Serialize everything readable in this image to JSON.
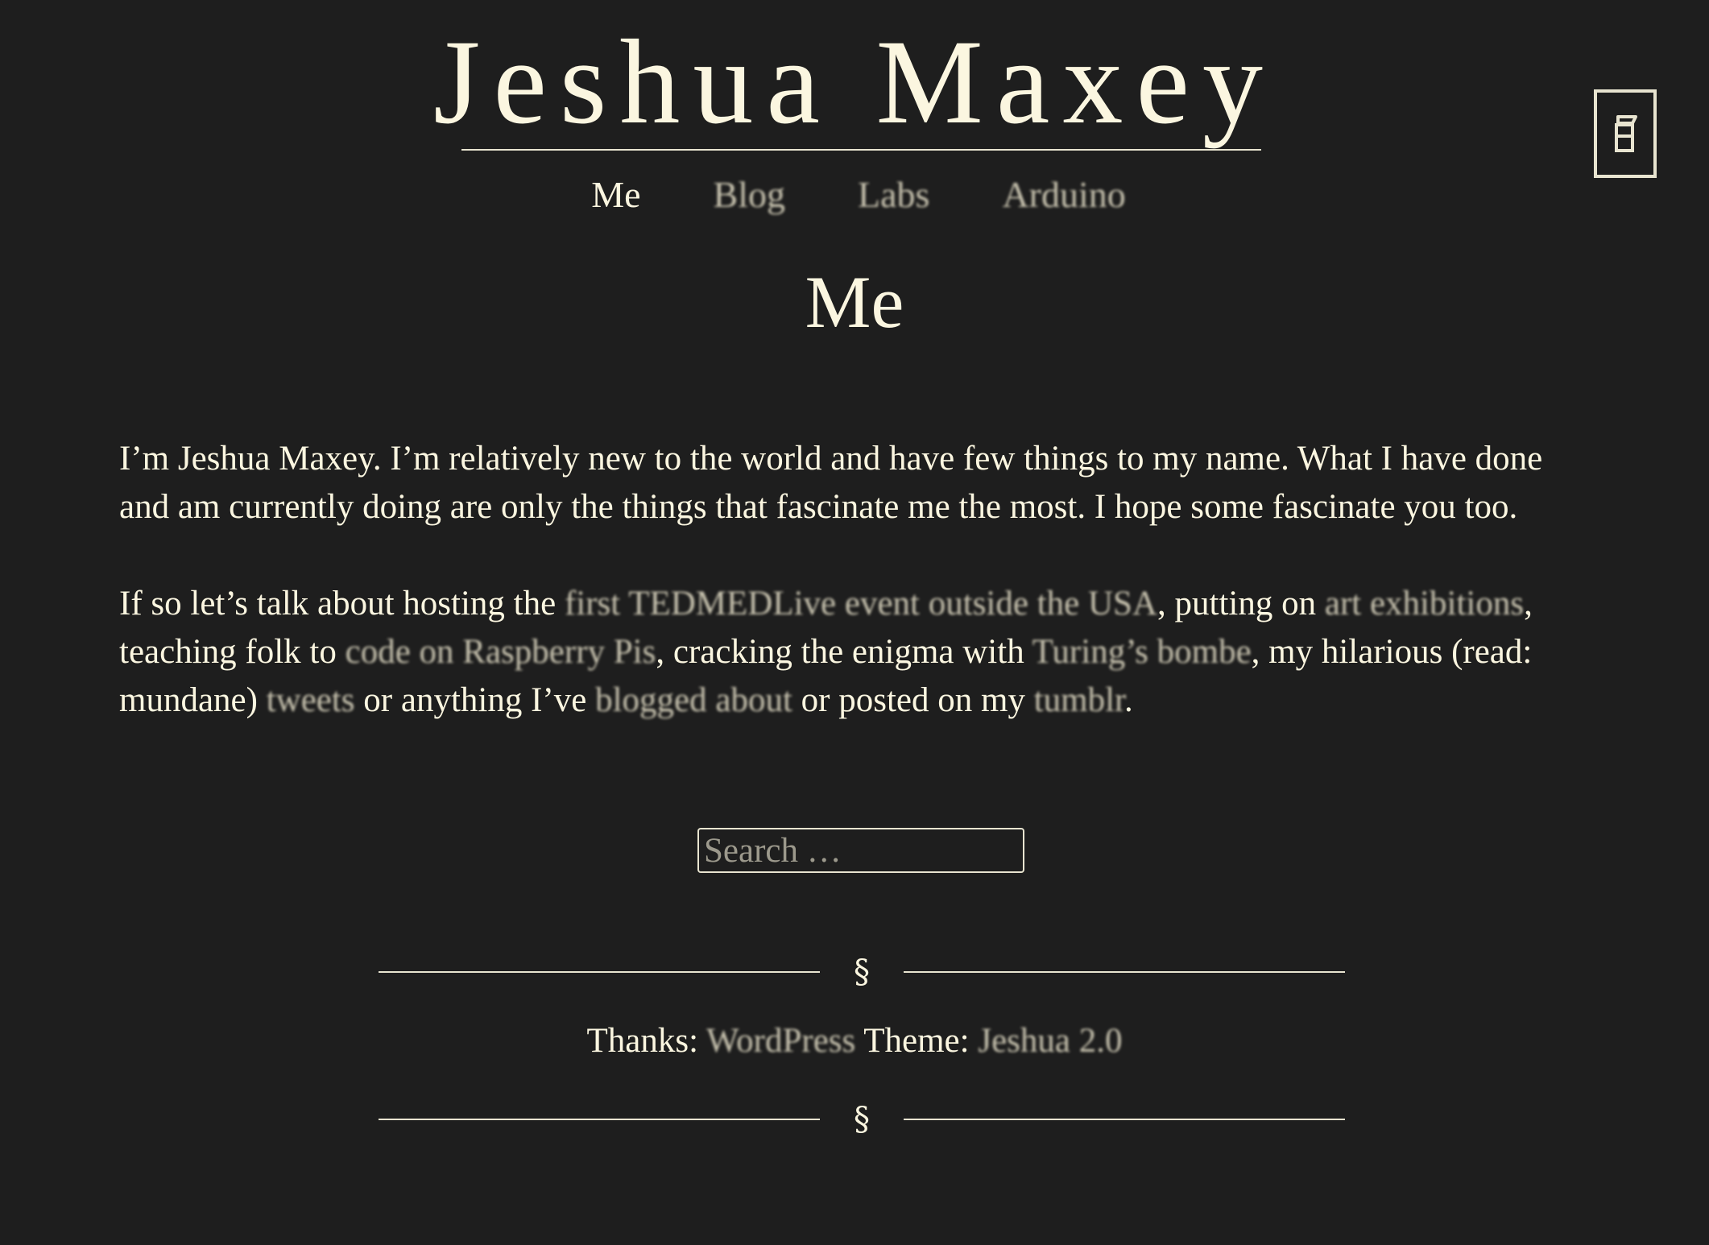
{
  "site": {
    "title": "Jeshua Maxey"
  },
  "nav": {
    "items": [
      {
        "label": "Me"
      },
      {
        "label": "Blog"
      },
      {
        "label": "Labs"
      },
      {
        "label": "Arduino"
      }
    ]
  },
  "corner_button": {
    "icon": "book-icon"
  },
  "page": {
    "heading": "Me"
  },
  "content": {
    "p1": "I’m Jeshua Maxey. I’m relatively new to the world and have few things to my name. What I have done and am currently doing are only the things that fascinate me the most. I hope some fascinate you too.",
    "p2": {
      "t1": "If so let’s talk about hosting the ",
      "l1": "first TEDMEDLive event outside the USA",
      "t2": ", putting on ",
      "l2": "art exhibitions",
      "t3": ", teaching folk to ",
      "l3": "code on Raspberry Pis",
      "t4": ", cracking the enigma with ",
      "l4": "Turing’s bombe",
      "t5": ", my hilarious (read: mundane) ",
      "l5": "tweets",
      "t6": " or anything I’ve ",
      "l6": "blogged about",
      "t7": " or posted on my ",
      "l7": "tumblr",
      "t8": "."
    }
  },
  "search": {
    "placeholder": "Search …"
  },
  "footer": {
    "divider_mark": "§",
    "thanks_label": "Thanks: ",
    "wordpress_link": "WordPress",
    "theme_label": " Theme: ",
    "theme_link": "Jeshua 2.0"
  },
  "colors": {
    "background": "#1e1e1e",
    "text": "#fbf6e0",
    "link": "#c9c4b0"
  }
}
